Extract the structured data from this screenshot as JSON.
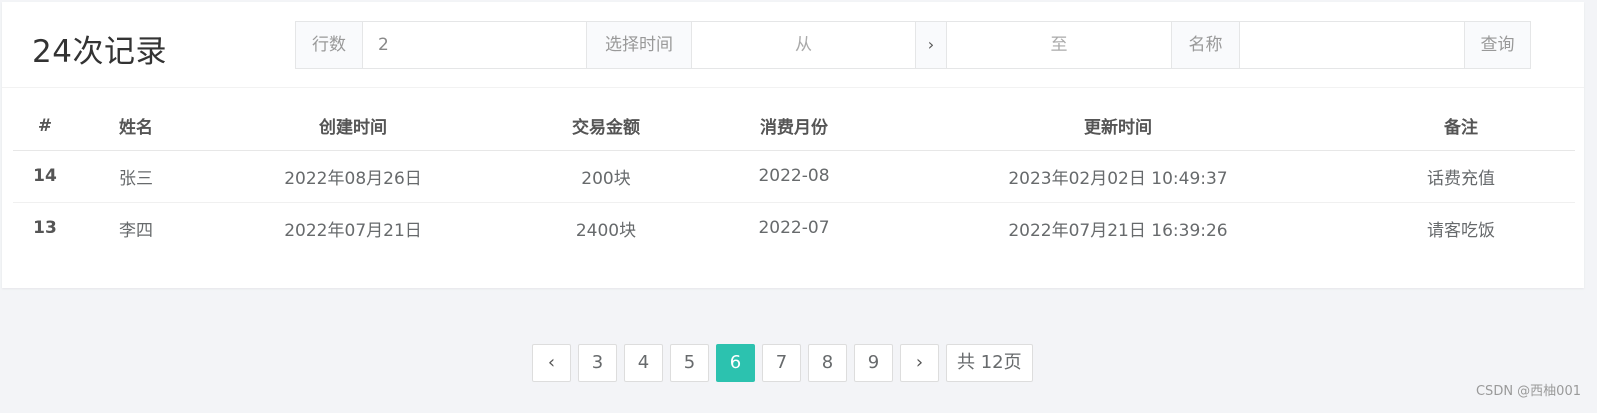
{
  "header": {
    "title": "24次记录"
  },
  "filters": {
    "rows_label": "行数",
    "rows_value": "2",
    "time_label": "选择时间",
    "from_placeholder": "从",
    "arrow": "›",
    "to_placeholder": "至",
    "name_label": "名称",
    "name_value": "",
    "query_label": "查询"
  },
  "table": {
    "columns": [
      "#",
      "姓名",
      "创建时间",
      "交易金额",
      "消费月份",
      "更新时间",
      "备注"
    ],
    "rows": [
      [
        "14",
        "张三",
        "2022年08月26日",
        "200块",
        "2022-08",
        "2023年02月02日 10:49:37",
        "话费充值"
      ],
      [
        "13",
        "李四",
        "2022年07月21日",
        "2400块",
        "2022-07",
        "2022年07月21日 16:39:26",
        "请客吃饭"
      ]
    ]
  },
  "pagination": {
    "prev": "‹",
    "pages": [
      "3",
      "4",
      "5",
      "6",
      "7",
      "8",
      "9"
    ],
    "current": "6",
    "next": "›",
    "total": "共 12页"
  },
  "watermark": "CSDN @西柚001",
  "colors": {
    "accent": "#2cc2af",
    "background": "#f3f4f7"
  }
}
